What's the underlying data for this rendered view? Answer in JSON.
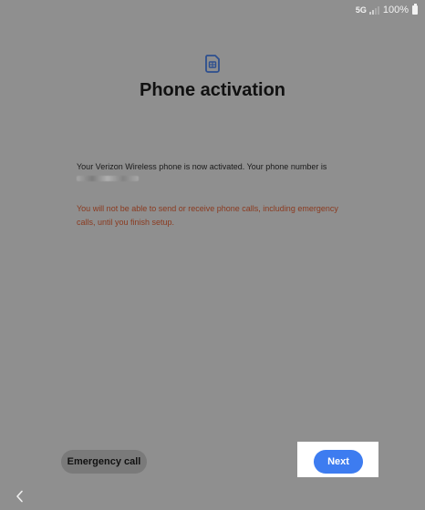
{
  "status_bar": {
    "network": "5G",
    "battery": "100%",
    "icons": [
      "signal-icon",
      "battery-icon"
    ]
  },
  "header": {
    "icon": "sim-card-icon",
    "title": "Phone activation"
  },
  "content": {
    "message": "Your Verizon Wireless phone is now activated. Your phone number is",
    "warning": "You will not be able to send or receive phone calls, including emergency calls, until you finish setup."
  },
  "footer": {
    "emergency_label": "Emergency call",
    "next_label": "Next"
  },
  "navigation": {
    "back_icon": "chevron-left-icon"
  },
  "colors": {
    "background": "#8f8f8f",
    "accent": "#3d7cf0",
    "warning": "#8b3a1f",
    "sim_icon": "#2d4f8f"
  }
}
